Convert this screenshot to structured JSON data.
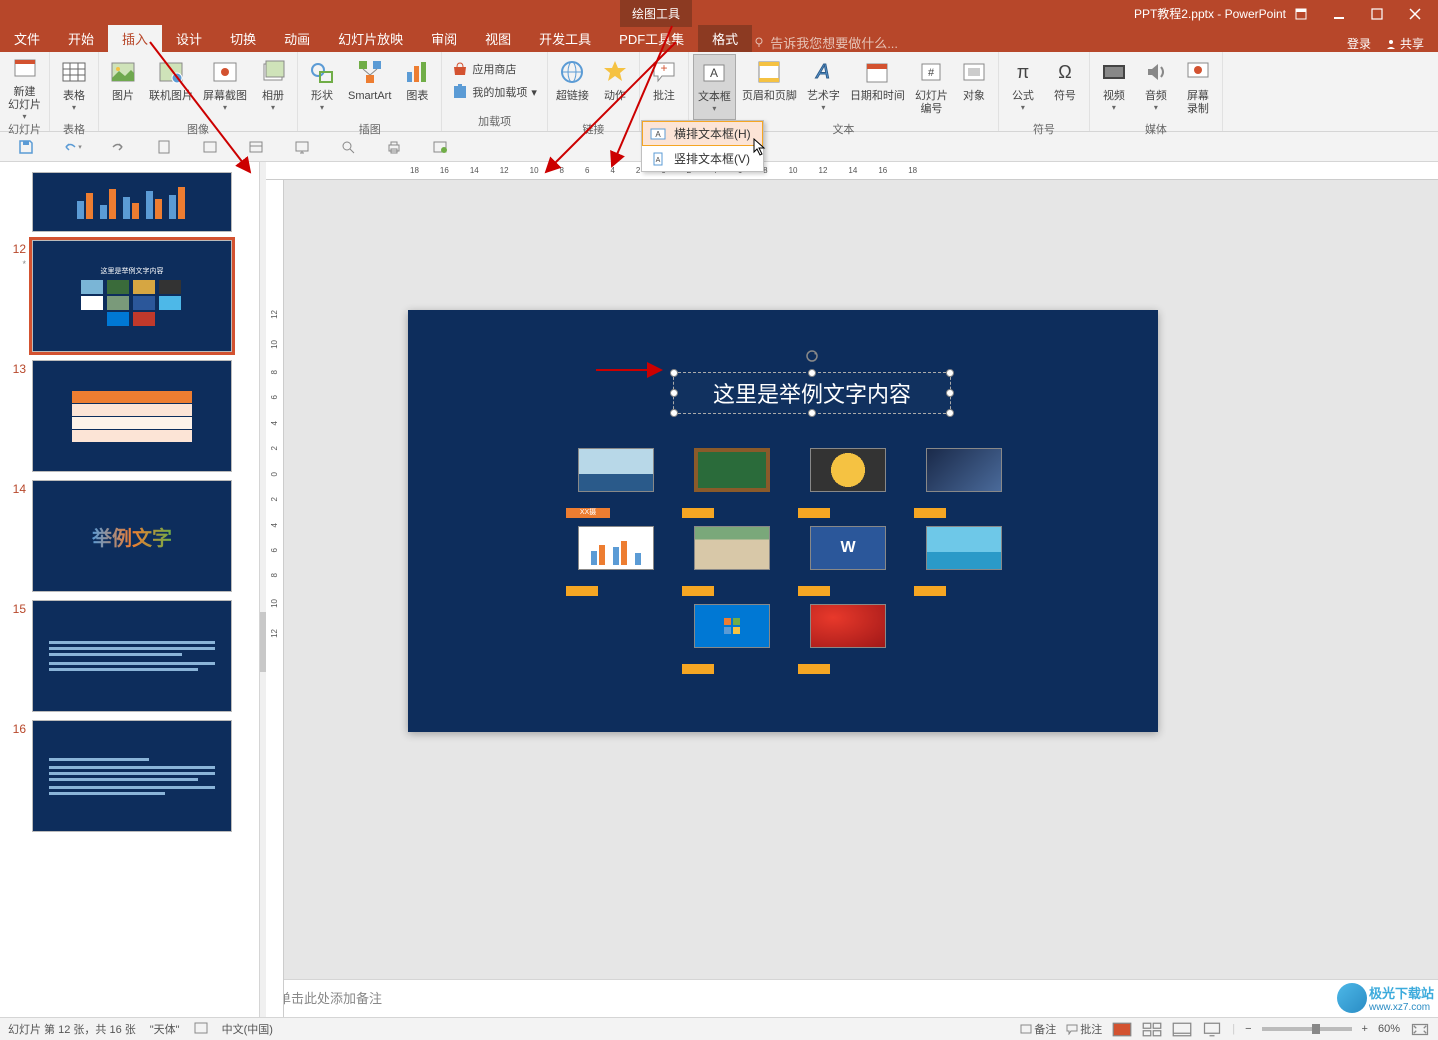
{
  "title": {
    "filename": "PPT教程2.pptx - PowerPoint",
    "context_tool": "绘图工具"
  },
  "window_controls": {
    "login": "登录",
    "share": "共享"
  },
  "tabs": {
    "items": [
      "文件",
      "开始",
      "插入",
      "设计",
      "切换",
      "动画",
      "幻灯片放映",
      "审阅",
      "视图",
      "开发工具",
      "PDF工具集"
    ],
    "context": "格式",
    "active_index": 2,
    "tell_me": "告诉我您想要做什么..."
  },
  "ribbon": {
    "groups": [
      {
        "label": "幻灯片",
        "items": [
          {
            "label": "新建\n幻灯片",
            "key": "new-slide"
          }
        ]
      },
      {
        "label": "表格",
        "items": [
          {
            "label": "表格",
            "key": "table"
          }
        ]
      },
      {
        "label": "图像",
        "items": [
          {
            "label": "图片",
            "key": "picture"
          },
          {
            "label": "联机图片",
            "key": "online-picture"
          },
          {
            "label": "屏幕截图",
            "key": "screenshot"
          },
          {
            "label": "相册",
            "key": "album"
          }
        ]
      },
      {
        "label": "插图",
        "items": [
          {
            "label": "形状",
            "key": "shapes"
          },
          {
            "label": "SmartArt",
            "key": "smartart"
          },
          {
            "label": "图表",
            "key": "chart"
          }
        ]
      },
      {
        "label": "加载项",
        "small_items": [
          {
            "label": "应用商店",
            "key": "store"
          },
          {
            "label": "我的加载项",
            "key": "my-addins",
            "caret": true
          }
        ]
      },
      {
        "label": "链接",
        "items": [
          {
            "label": "超链接",
            "key": "hyperlink"
          },
          {
            "label": "动作",
            "key": "action"
          }
        ]
      },
      {
        "label": "批注",
        "items": [
          {
            "label": "批注",
            "key": "comment"
          }
        ]
      },
      {
        "label": "文本",
        "items": [
          {
            "label": "文本框",
            "key": "textbox",
            "active": true,
            "caret": true
          },
          {
            "label": "页眉和页脚",
            "key": "header-footer"
          },
          {
            "label": "艺术字",
            "key": "wordart"
          },
          {
            "label": "日期和时间",
            "key": "datetime"
          },
          {
            "label": "幻灯片\n编号",
            "key": "slide-number"
          },
          {
            "label": "对象",
            "key": "object"
          }
        ]
      },
      {
        "label": "符号",
        "items": [
          {
            "label": "公式",
            "key": "equation"
          },
          {
            "label": "符号",
            "key": "symbol"
          }
        ]
      },
      {
        "label": "媒体",
        "items": [
          {
            "label": "视频",
            "key": "video"
          },
          {
            "label": "音频",
            "key": "audio"
          },
          {
            "label": "屏幕\n录制",
            "key": "screen-record"
          }
        ]
      }
    ]
  },
  "dropdown": {
    "items": [
      {
        "label": "横排文本框(H)",
        "key": "horizontal-textbox",
        "hover": true
      },
      {
        "label": "竖排文本框(V)",
        "key": "vertical-textbox"
      }
    ]
  },
  "ruler_h": [
    "18",
    "16",
    "14",
    "12",
    "10",
    "8",
    "6",
    "4",
    "2",
    "0",
    "2",
    "4",
    "6",
    "8",
    "10",
    "12",
    "14",
    "16",
    "18"
  ],
  "ruler_v": [
    "12",
    "10",
    "8",
    "6",
    "4",
    "2",
    "0",
    "2",
    "4",
    "6",
    "8",
    "10",
    "12"
  ],
  "slide": {
    "textbox_value": "这里是举例文字内容",
    "img_tag": "XX摄"
  },
  "thumbnails": {
    "visible": [
      {
        "num": "",
        "kind": "chart"
      },
      {
        "num": "12",
        "kind": "grid",
        "selected": true,
        "title": "这里是举例文字内容",
        "star": "*"
      },
      {
        "num": "13",
        "kind": "table"
      },
      {
        "num": "14",
        "kind": "art",
        "text": "举例文字"
      },
      {
        "num": "15",
        "kind": "text"
      },
      {
        "num": "16",
        "kind": "text"
      }
    ]
  },
  "notes": {
    "placeholder": "单击此处添加备注"
  },
  "status": {
    "slide_info": "幻灯片 第 12 张，共 16 张",
    "theme": "\"天体\"",
    "lang": "中文(中国)",
    "notes_btn": "备注",
    "comments_btn": "批注",
    "zoom": "60%"
  },
  "watermark": {
    "text": "极光下载站",
    "url": "www.xz7.com"
  },
  "colors": {
    "ribbon_bg": "#b7472a",
    "slide_bg": "#0d2d5c",
    "accent": "#f5a623"
  }
}
